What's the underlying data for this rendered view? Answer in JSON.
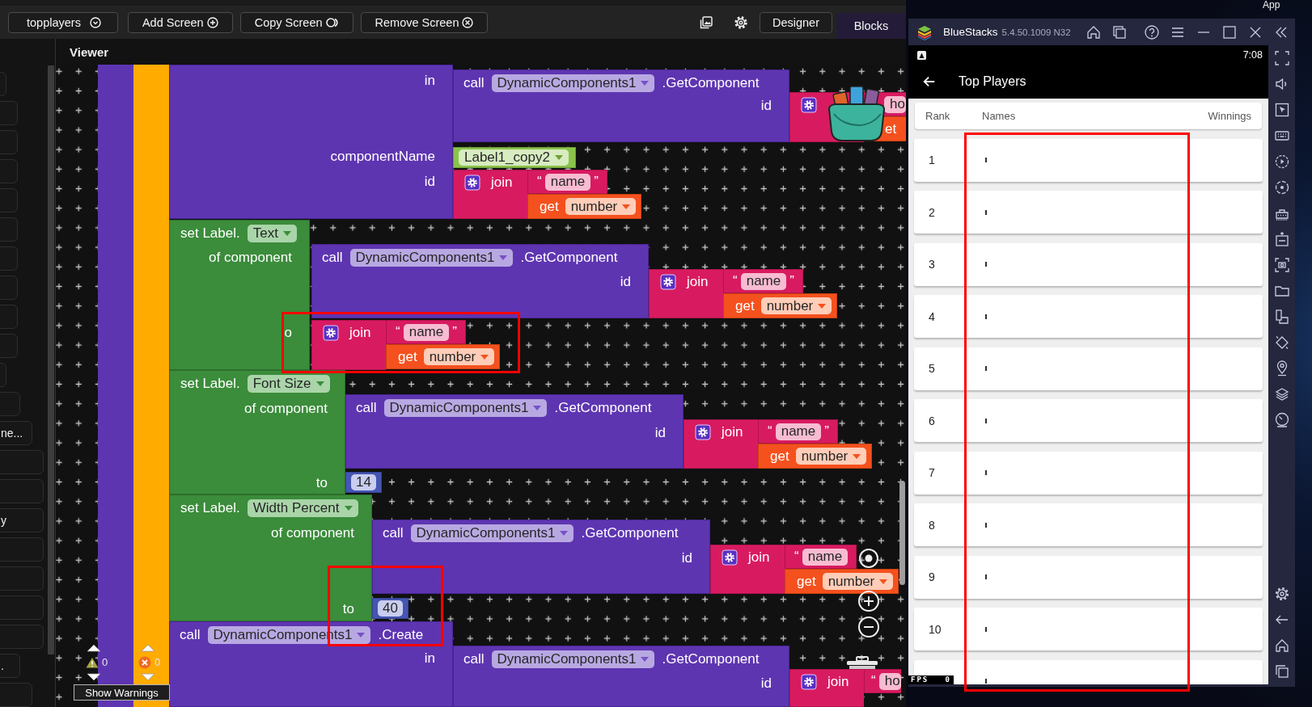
{
  "toolbar": {
    "screen": "topplayers",
    "screen_actions": [
      {
        "kind": "add",
        "label": "Add Screen"
      },
      {
        "kind": "copy",
        "label": "Copy Screen"
      },
      {
        "kind": "remove",
        "label": "Remove Screen"
      }
    ],
    "views": [
      {
        "label": "Designer",
        "selected": false
      },
      {
        "label": "Blocks",
        "selected": true
      }
    ]
  },
  "left_panel": {
    "items": [
      {
        "kind": "blank"
      },
      {
        "kind": "blank"
      },
      {
        "kind": "blank"
      },
      {
        "kind": "blank"
      },
      {
        "kind": "blank"
      },
      {
        "kind": "blank"
      },
      {
        "kind": "blank"
      },
      {
        "kind": "blank"
      },
      {
        "kind": "blank"
      },
      {
        "kind": "blank"
      },
      {
        "kind": "blank"
      },
      {
        "kind": "blank"
      },
      {
        "kind": "labeled",
        "label": "ne..."
      },
      {
        "kind": "blank"
      },
      {
        "kind": "blank"
      },
      {
        "kind": "labeled",
        "label": "y"
      },
      {
        "kind": "blank"
      },
      {
        "kind": "blank"
      },
      {
        "kind": "blank"
      },
      {
        "kind": "blank"
      },
      {
        "kind": "labeled",
        "label": "."
      },
      {
        "kind": "blank"
      }
    ]
  },
  "viewer": {
    "title": "Viewer"
  },
  "workspace": {
    "blocks": [
      {
        "kind": "edge",
        "color": "#5e35b1"
      },
      {
        "kind": "edge",
        "color": "#ffab00"
      },
      {
        "kind": "call",
        "slots": [
          "in",
          "componentName",
          "id"
        ]
      },
      {
        "kind": "call",
        "keyword": "call",
        "component": "DynamicComponents1",
        "method": ".GetComponent",
        "slots": [
          "id"
        ]
      },
      {
        "kind": "join",
        "string": {
          "value": "ho"
        },
        "get": {
          "word": "et"
        }
      },
      {
        "kind": "component",
        "component": "Label1_copy2"
      },
      {
        "kind": "join",
        "word": "join",
        "string": {
          "open": "“",
          "value": "name",
          "close": "”"
        },
        "get": {
          "word": "get",
          "variable": "number"
        }
      },
      {
        "kind": "setter",
        "word": "set Label.",
        "property": "Text",
        "slots": [
          "of component",
          "o"
        ]
      },
      {
        "kind": "call",
        "keyword": "call",
        "component": "DynamicComponents1",
        "method": ".GetComponent",
        "slots": [
          "id"
        ]
      },
      {
        "kind": "join",
        "word": "join",
        "string": {
          "open": "“",
          "value": "name",
          "close": "”"
        },
        "get": {
          "word": "get",
          "variable": "number"
        }
      },
      {
        "kind": "join",
        "word": "join",
        "string": {
          "open": "“",
          "value": "name",
          "close": "”"
        },
        "get": {
          "word": "get",
          "variable": "number"
        }
      },
      {
        "kind": "setter",
        "word": "set Label.",
        "property": "Font Size",
        "slots": [
          "of component",
          "to"
        ]
      },
      {
        "kind": "call",
        "keyword": "call",
        "component": "DynamicComponents1",
        "method": ".GetComponent",
        "slots": [
          "id"
        ]
      },
      {
        "kind": "join",
        "word": "join",
        "string": {
          "open": "“",
          "value": "name",
          "close": "”"
        },
        "get": {
          "word": "get",
          "variable": "number"
        }
      },
      {
        "kind": "number",
        "value": "14"
      },
      {
        "kind": "setter",
        "word": "set Label.",
        "property": "Width Percent",
        "slots": [
          "of component",
          "to"
        ]
      },
      {
        "kind": "call",
        "keyword": "call",
        "component": "DynamicComponents1",
        "method": ".GetComponent",
        "slots": [
          "id"
        ]
      },
      {
        "kind": "join",
        "word": "join",
        "string": {
          "open": "“",
          "value": "name"
        },
        "get": {
          "word": "get",
          "variable": "number"
        }
      },
      {
        "kind": "number",
        "value": "40"
      },
      {
        "kind": "call",
        "keyword": "call",
        "component": "DynamicComponents1",
        "method": ".Create",
        "slots": [
          "in"
        ]
      },
      {
        "kind": "call",
        "keyword": "call",
        "component": "DynamicComponents1",
        "method": ".GetComponent",
        "slots": [
          "id"
        ]
      },
      {
        "kind": "join",
        "word": "join",
        "string": {
          "open": "“",
          "value": "ho"
        }
      }
    ],
    "warnings": {
      "warning_count": "0",
      "error_count": "0",
      "toggle": "Show Warnings"
    }
  },
  "annotations": [
    {
      "kind": "frame"
    },
    {
      "kind": "frame"
    },
    {
      "kind": "frame"
    }
  ],
  "desktop": {
    "label": "App"
  },
  "emulator": {
    "title": "BlueStacks",
    "version": "5.4.50.1009 N32",
    "screen": {
      "time": "7:08",
      "app_title": "Top Players",
      "columns": [
        "Rank",
        "Names",
        "Winnings"
      ],
      "rows": [
        {
          "kind": "full",
          "rank": "1"
        },
        {
          "kind": "full",
          "rank": "2"
        },
        {
          "kind": "full",
          "rank": "3"
        },
        {
          "kind": "full",
          "rank": "4"
        },
        {
          "kind": "full",
          "rank": "5"
        },
        {
          "kind": "full",
          "rank": "6"
        },
        {
          "kind": "full",
          "rank": "7"
        },
        {
          "kind": "full",
          "rank": "8"
        },
        {
          "kind": "full",
          "rank": "9"
        },
        {
          "kind": "full",
          "rank": "10"
        },
        {
          "kind": "cut"
        }
      ],
      "fps": {
        "label": "FPS",
        "value": "0"
      }
    }
  }
}
